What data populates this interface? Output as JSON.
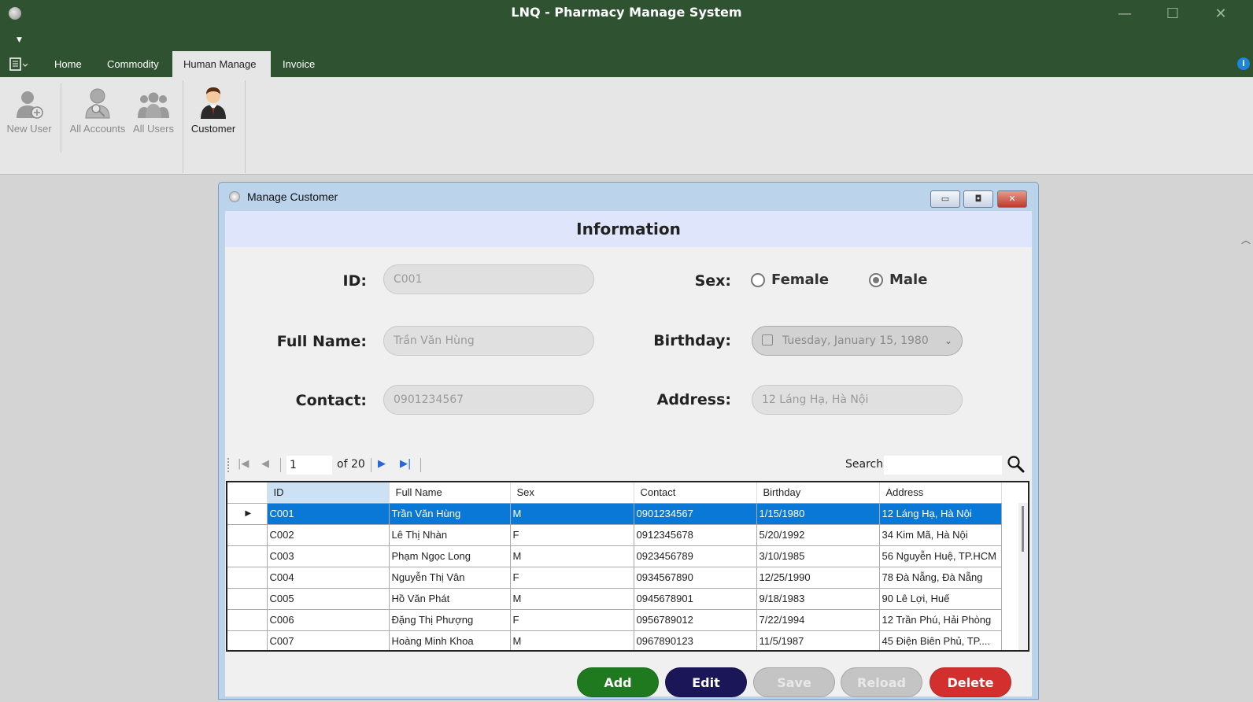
{
  "app": {
    "title": "LNQ - Pharmacy Manage System"
  },
  "window_controls": {
    "minimize": "—",
    "maximize": "☐",
    "close": "✕"
  },
  "tabs": [
    {
      "label": "Home"
    },
    {
      "label": "Commodity"
    },
    {
      "label": "Human Manage",
      "active": true
    },
    {
      "label": "Invoice"
    }
  ],
  "ribbon": {
    "items": [
      {
        "label": "New User",
        "icon": "new-user-icon"
      },
      {
        "label": "All Accounts",
        "icon": "all-accounts-icon"
      },
      {
        "label": "All Users",
        "icon": "all-users-icon"
      },
      {
        "label": "Customer",
        "icon": "customer-icon"
      }
    ]
  },
  "child_window": {
    "title": "Manage Customer",
    "header": "Information"
  },
  "form": {
    "id_label": "ID:",
    "id_value": "C001",
    "fullname_label": "Full Name:",
    "fullname_value": "Trần Văn Hùng",
    "contact_label": "Contact:",
    "contact_value": "0901234567",
    "sex_label": "Sex:",
    "sex_options": [
      "Female",
      "Male"
    ],
    "sex_selected": "Male",
    "birthday_label": "Birthday:",
    "birthday_value": "Tuesday, January 15, 1980",
    "address_label": "Address:",
    "address_value": "12 Láng Hạ, Hà Nội"
  },
  "navigator": {
    "position": "1",
    "of_label": "of 20",
    "search_label": "Search"
  },
  "grid": {
    "columns": [
      "ID",
      "Full Name",
      "Sex",
      "Contact",
      "Birthday",
      "Address"
    ],
    "rows": [
      [
        "C001",
        "Trần Văn Hùng",
        "M",
        "0901234567",
        "1/15/1980",
        "12 Láng Hạ, Hà Nội"
      ],
      [
        "C002",
        "Lê Thị Nhàn",
        "F",
        "0912345678",
        "5/20/1992",
        "34 Kim Mã, Hà Nội"
      ],
      [
        "C003",
        "Phạm Ngọc Long",
        "M",
        "0923456789",
        "3/10/1985",
        "56 Nguyễn Huệ, TP.HCM"
      ],
      [
        "C004",
        "Nguyễn Thị Vân",
        "F",
        "0934567890",
        "12/25/1990",
        "78 Đà Nẵng, Đà Nẵng"
      ],
      [
        "C005",
        "Hồ Văn Phát",
        "M",
        "0945678901",
        "9/18/1983",
        "90 Lê Lợi, Huế"
      ],
      [
        "C006",
        "Đặng Thị Phượng",
        "F",
        "0956789012",
        "7/22/1994",
        "12 Trần Phú, Hải Phòng"
      ],
      [
        "C007",
        "Hoàng Minh Khoa",
        "M",
        "0967890123",
        "11/5/1987",
        "45 Điện Biên Phủ, TP...."
      ]
    ],
    "selected_row": 0
  },
  "buttons": {
    "add": "Add",
    "edit": "Edit",
    "save": "Save",
    "reload": "Reload",
    "delete": "Delete"
  },
  "colors": {
    "titlebar": "#2f5230",
    "add": "#1f7a1f",
    "edit": "#1b1658",
    "disabled": "#c4c4c4",
    "delete": "#d32f2f",
    "selection": "#0a78d7"
  }
}
